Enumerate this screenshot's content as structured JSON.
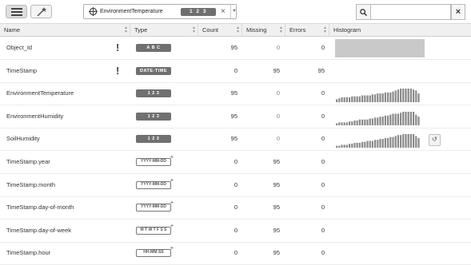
{
  "toolbar": {
    "column_selector": {
      "label": "EnvironmentTemperature",
      "type_badge": "1 2 3"
    }
  },
  "search": {
    "value": ""
  },
  "columns": [
    "Name",
    "Type",
    "Count",
    "Missing",
    "Errors",
    "Histogram"
  ],
  "rows": [
    {
      "name": "Object_Id",
      "required": "!",
      "type": "A B C",
      "count": "95",
      "missing": "0",
      "errors": "0",
      "histogram": "blank"
    },
    {
      "name": "TimeStamp",
      "required": "!",
      "type": "DATE-TIME",
      "count": "0",
      "missing": "95",
      "errors": "95",
      "histogram": "none"
    },
    {
      "name": "EnvironmentTemperature",
      "required": "",
      "type": "1 2 3",
      "count": "95",
      "missing": "0",
      "errors": "0",
      "histogram": [
        3,
        4,
        5,
        5,
        5,
        5,
        6,
        6,
        6,
        6,
        7,
        7,
        7,
        7,
        8,
        8,
        9,
        9,
        9,
        10,
        10,
        10,
        11,
        12,
        13,
        14,
        14,
        14,
        14,
        14,
        13,
        12,
        9
      ]
    },
    {
      "name": "EnvironmentHumidity",
      "required": "",
      "type": "1 2 3",
      "count": "95",
      "missing": "0",
      "errors": "0",
      "histogram": [
        2,
        3,
        3,
        3,
        3,
        4,
        4,
        5,
        5,
        6,
        6,
        6,
        6,
        7,
        7,
        8,
        8,
        9,
        9,
        10,
        10,
        11,
        12,
        12,
        12,
        13,
        14,
        14,
        14,
        14,
        14,
        11,
        9
      ]
    },
    {
      "name": "SoilHumidity",
      "required": "",
      "type": "1 2 3",
      "count": "95",
      "missing": "0",
      "errors": "0",
      "histogram": [
        2,
        2,
        3,
        3,
        3,
        4,
        4,
        5,
        5,
        5,
        6,
        6,
        7,
        7,
        7,
        8,
        8,
        9,
        9,
        10,
        10,
        11,
        11,
        12,
        13,
        13,
        14,
        14,
        14,
        14,
        14,
        12,
        10
      ],
      "refresh": "↺"
    },
    {
      "name": "TimeStamp.year",
      "required": "",
      "type": "YYYY-MM-DD",
      "count": "0",
      "missing": "95",
      "errors": "0",
      "histogram": "none"
    },
    {
      "name": "TimeStamp.month",
      "required": "",
      "type": "YYYY-MM-DD",
      "count": "0",
      "missing": "95",
      "errors": "0",
      "histogram": "none"
    },
    {
      "name": "TimeStamp.day-of-month",
      "required": "",
      "type": "YYYY-MM-DD",
      "count": "0",
      "missing": "95",
      "errors": "0",
      "histogram": "none"
    },
    {
      "name": "TimeStamp.day-of-week",
      "required": "",
      "type": "M T W T F S S",
      "count": "0",
      "missing": "95",
      "errors": "0",
      "histogram": "none"
    },
    {
      "name": "TimeStamp.hour",
      "required": "",
      "type": "HH:MM:SS",
      "count": "0",
      "missing": "95",
      "errors": "0",
      "histogram": "none"
    }
  ]
}
